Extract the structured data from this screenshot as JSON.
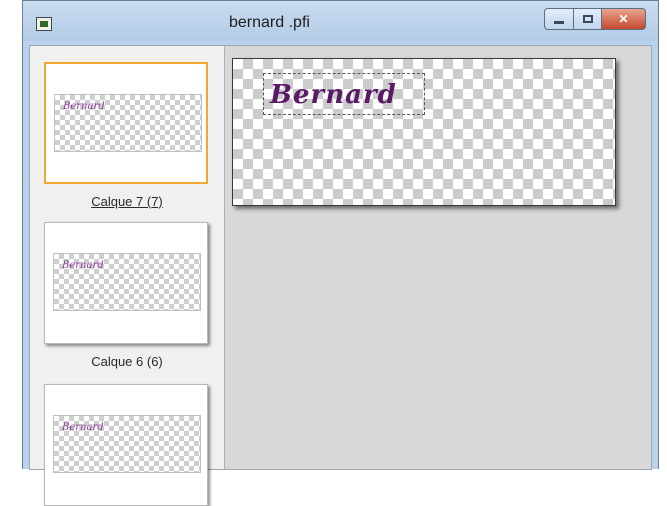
{
  "window": {
    "title": "bernard .pfi",
    "icon": "pfi-document-icon",
    "controls": {
      "minimize": "minimize-icon",
      "maximize": "maximize-icon",
      "close": "close-icon"
    }
  },
  "layers": [
    {
      "label": "Calque 7 (7)",
      "thumb_text": "Bernard",
      "selected": true
    },
    {
      "label": "Calque 6 (6)",
      "thumb_text": "Bernard",
      "selected": false
    },
    {
      "label": "",
      "thumb_text": "Bernard",
      "selected": false
    }
  ],
  "canvas": {
    "text": "Bernard",
    "text_color": "#5a1a66"
  },
  "colors": {
    "selected_border": "#f0a830",
    "workspace": "#d8d8d8",
    "titlebar": "#b9d1ea"
  }
}
